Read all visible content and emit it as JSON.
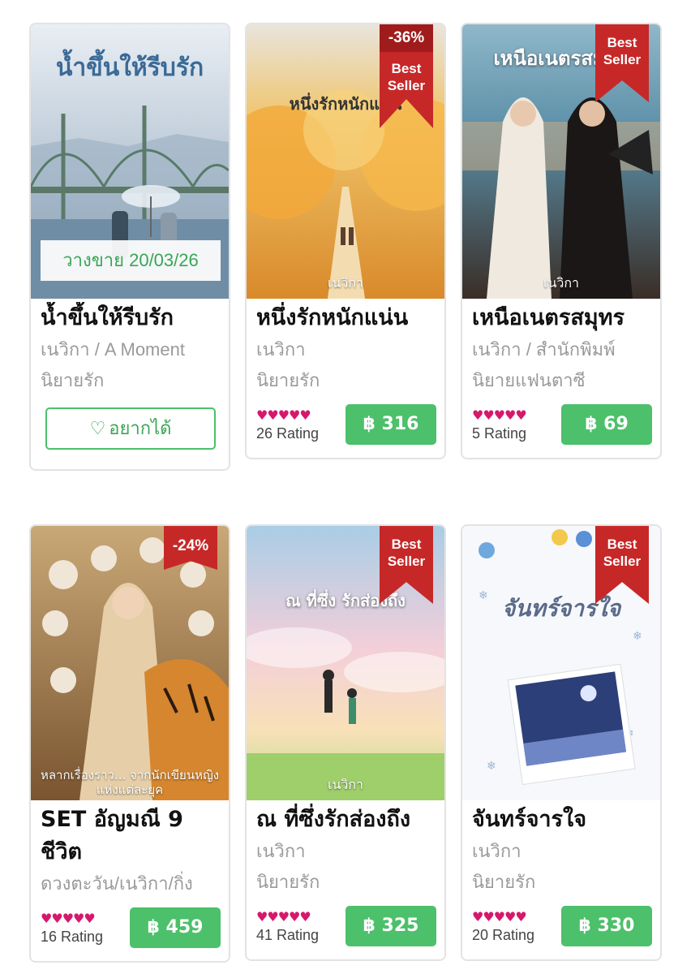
{
  "colors": {
    "price_green": "#4cc06a",
    "ribbon_red": "#c62828",
    "star_pink": "#d6186c",
    "muted_text": "#9a9a9a"
  },
  "books": [
    {
      "title": "น้ำขึ้นให้รีบรัก",
      "author": "เนวิกา / A Moment",
      "genre": "นิยายรัก",
      "cover_text": "น้ำขึ้นให้รีบรัก",
      "release": "วางขาย 20/03/26",
      "wishlist_label": "อยากได้",
      "wishlist_icon": "heart-outline-icon"
    },
    {
      "title": "หนึ่งรักหนักแน่น",
      "author": "เนวิกา",
      "genre": "นิยายรัก",
      "cover_text": "หนึ่งรักหนักแน่น",
      "cover_author": "เนวิกา",
      "discount": "-36%",
      "badge": "Best Seller",
      "stars": "♥♥♥♥♥",
      "rating": "26 Rating",
      "price": "฿ 316"
    },
    {
      "title": "เหนือเนตรสมุทร",
      "author": "เนวิกา / สำนักพิมพ์",
      "genre": "นิยายแฟนตาซี",
      "cover_text": "เหนือเนตรสมุทร",
      "cover_author": "เนวิกา",
      "badge": "Best Seller",
      "stars": "♥♥♥♥♥",
      "rating": "5 Rating",
      "price": "฿ 69"
    },
    {
      "title": "SET อัญมณี 9 ชีวิต",
      "author": "ดวงตะวัน/เนวิกา/กิ่ง",
      "genre": "",
      "cover_text": "หลากเรื่องราว... จากนักเขียนหญิงแห่งแต่ละยุค",
      "discount": "-24%",
      "stars": "♥♥♥♥♥",
      "rating": "16 Rating",
      "price": "฿ 459"
    },
    {
      "title": "ณ ที่ซึ่งรักส่องถึง",
      "author": "เนวิกา",
      "genre": "นิยายรัก",
      "cover_text": "ณ ที่ซึ่ง รักส่องถึง",
      "cover_author": "เนวิกา",
      "badge": "Best Seller",
      "stars": "♥♥♥♥♥",
      "rating": "41 Rating",
      "price": "฿ 325"
    },
    {
      "title": "จันทร์จารใจ",
      "author": "เนวิกา",
      "genre": "นิยายรัก",
      "cover_text": "จันทร์จารใจ",
      "badge": "Best Seller",
      "stars": "♥♥♥♥♥",
      "rating": "20 Rating",
      "price": "฿ 330"
    }
  ]
}
